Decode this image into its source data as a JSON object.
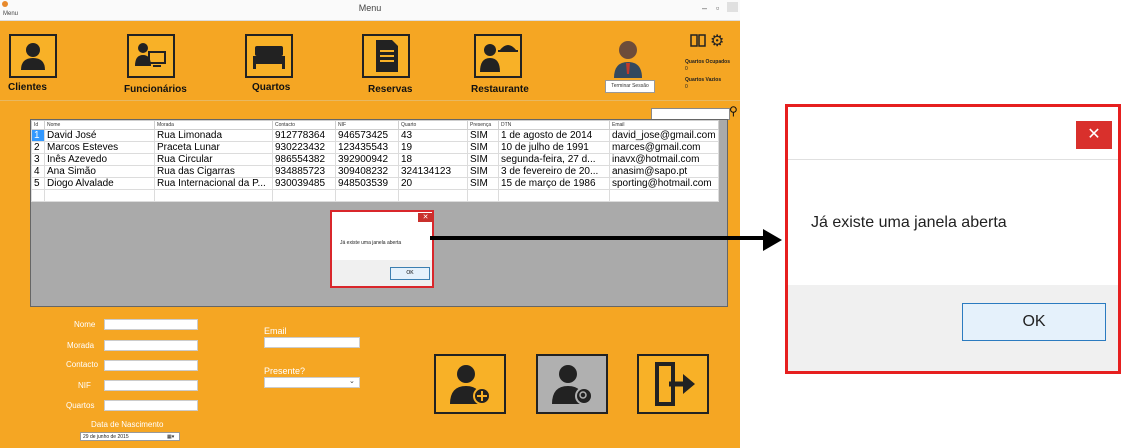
{
  "window": {
    "title": "Menu",
    "menu_label": "Menu",
    "minimize": "–",
    "maximize": "▫"
  },
  "nav": [
    {
      "label": "Clientes"
    },
    {
      "label": "Funcionários"
    },
    {
      "label": "Quartos"
    },
    {
      "label": "Reservas"
    },
    {
      "label": "Restaurante"
    }
  ],
  "session": {
    "logout_label": "Terminar Sessão",
    "occupied_label": "Quartos Ocupados",
    "occupied_value": "0",
    "empty_label": "Quartos Vazios",
    "empty_value": "0"
  },
  "table": {
    "columns": [
      "Id",
      "Nome",
      "Morada",
      "Contacto",
      "NIF",
      "Quarto",
      "Presença",
      "DTN",
      "Email"
    ],
    "rows": [
      [
        "1",
        "David José",
        "Rua Limonada",
        "912778364",
        "946573425",
        "43",
        "SIM",
        "1 de agosto de 2014",
        "david_jose@gmail.com"
      ],
      [
        "2",
        "Marcos Esteves",
        "Praceta Lunar",
        "930223432",
        "123435543",
        "19",
        "SIM",
        "10 de julho de 1991",
        "marces@gmail.com"
      ],
      [
        "3",
        "Inês Azevedo",
        "Rua Circular",
        "986554382",
        "392900942",
        "18",
        "SIM",
        "segunda-feira, 27 d...",
        "inavx@hotmail.com"
      ],
      [
        "4",
        "Ana Simão",
        "Rua das Cigarras",
        "934885723",
        "309408232",
        "324134123",
        "SIM",
        "3 de fevereiro de 20...",
        "anasim@sapo.pt"
      ],
      [
        "5",
        "Diogo Alvalade",
        "Rua Internacional da P...",
        "930039485",
        "948503539",
        "20",
        "SIM",
        "15 de março de 1986",
        "sporting@hotmail.com"
      ]
    ]
  },
  "form": {
    "nome_label": "Nome",
    "morada_label": "Morada",
    "contacto_label": "Contacto",
    "nif_label": "NIF",
    "quartos_label": "Quartos",
    "email_label": "Email",
    "presente_label": "Presente?",
    "dob_label": "Data de Nascimento",
    "dob_day": "29",
    "dob_weekday": "de",
    "dob_month": "junho",
    "dob_of": "de",
    "dob_year": "2015"
  },
  "small_dialog": {
    "message": "Já existe uma janela aberta",
    "ok_label": "OK"
  },
  "large_dialog": {
    "message": "Já existe uma janela aberta",
    "ok_label": "OK",
    "close_glyph": "✕"
  }
}
